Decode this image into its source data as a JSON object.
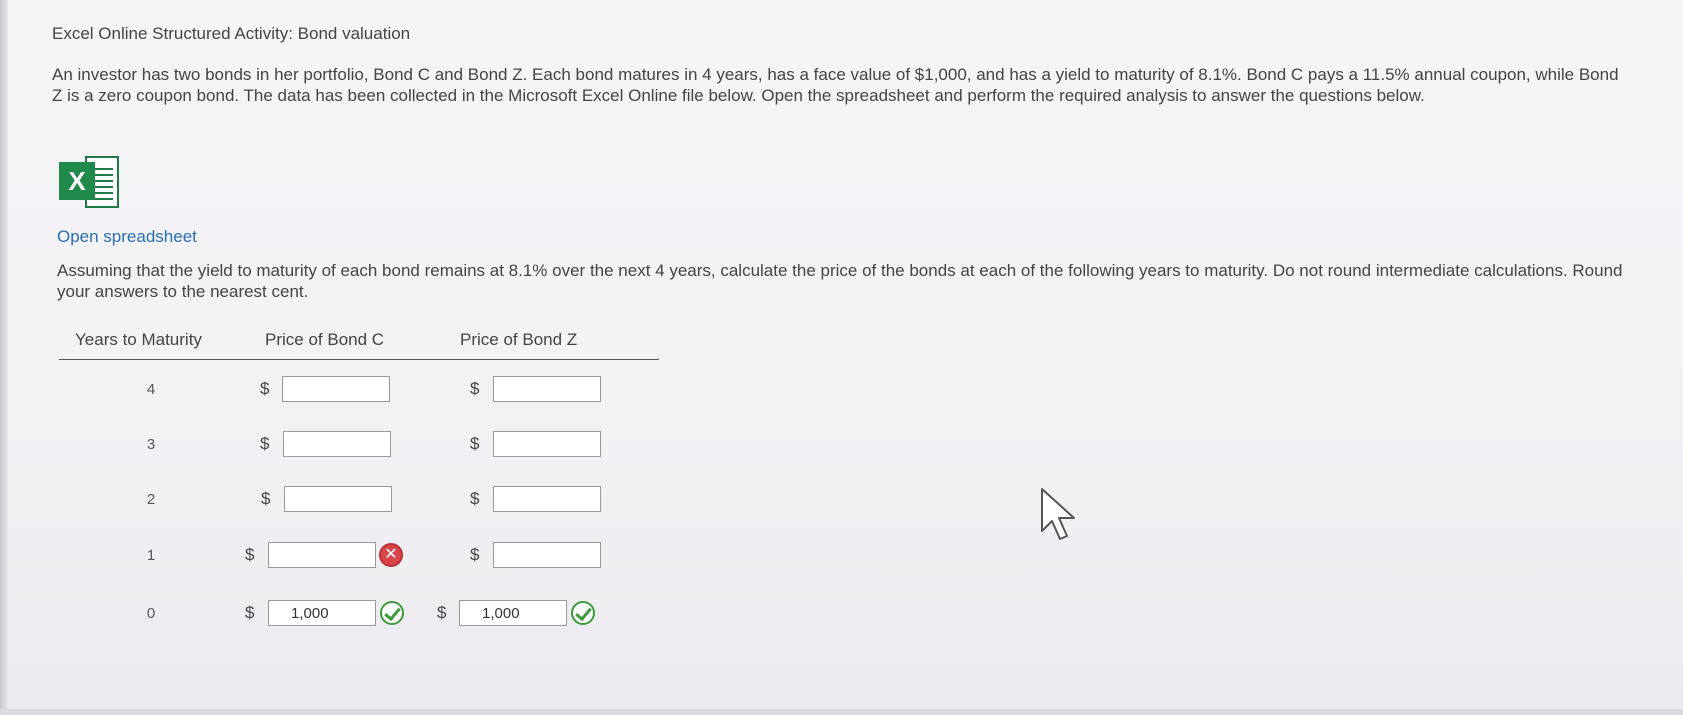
{
  "activity": {
    "title": "Excel Online Structured Activity: Bond valuation",
    "intro": "An investor has two bonds in her portfolio, Bond C and Bond Z. Each bond matures in 4 years, has a face value of $1,000, and has a yield to maturity of 8.1%. Bond C pays a 11.5% annual coupon, while Bond Z is a zero coupon bond. The data has been collected in the Microsoft Excel Online file below. Open the spreadsheet and perform the required analysis to answer the questions below.",
    "excel_icon_letter": "X",
    "open_spreadsheet_label": "Open spreadsheet",
    "question": "Assuming that the yield to maturity of each bond remains at 8.1% over the next 4 years, calculate the price of the bonds at each of the following years to maturity. Do not round intermediate calculations. Round your answers to the nearest cent."
  },
  "table": {
    "headers": {
      "years": "Years to Maturity",
      "bond_c": "Price of Bond C",
      "bond_z": "Price of Bond Z"
    },
    "currency_symbol": "$",
    "rows": [
      {
        "year": "4",
        "bond_c": {
          "value": "",
          "status": ""
        },
        "bond_z": {
          "value": "",
          "status": ""
        }
      },
      {
        "year": "3",
        "bond_c": {
          "value": "",
          "status": ""
        },
        "bond_z": {
          "value": "",
          "status": ""
        }
      },
      {
        "year": "2",
        "bond_c": {
          "value": "",
          "status": ""
        },
        "bond_z": {
          "value": "",
          "status": ""
        }
      },
      {
        "year": "1",
        "bond_c": {
          "value": "",
          "status": "incorrect"
        },
        "bond_z": {
          "value": "",
          "status": ""
        }
      },
      {
        "year": "0",
        "bond_c": {
          "value": "1,000",
          "status": "correct"
        },
        "bond_z": {
          "value": "1,000",
          "status": "correct"
        }
      }
    ]
  },
  "icons": {
    "correct": "checkmark-circle-icon",
    "incorrect": "x-circle-icon",
    "cursor": "mouse-pointer-icon"
  },
  "colors": {
    "link": "#2a6fb5",
    "excel_green": "#1f8a4c",
    "correct_green": "#3c9a3c",
    "incorrect_red": "#d9454a"
  }
}
